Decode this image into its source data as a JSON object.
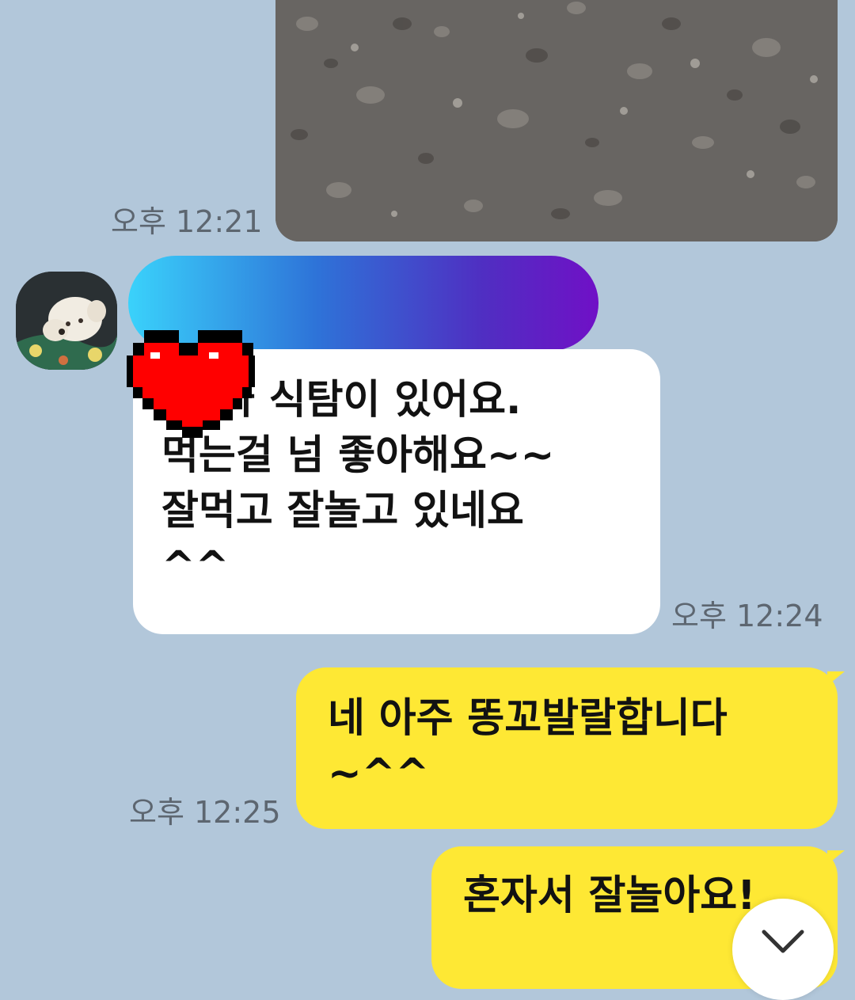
{
  "chat": {
    "messages": [
      {
        "sender": "me",
        "type": "photo",
        "time": "오후 12:21"
      },
      {
        "sender": "partner",
        "type": "text",
        "text": "    가 식탐이 있어요.\n먹는걸 넘 좋아해요~~\n잘먹고 잘놀고 있네요\n^^",
        "time": "오후 12:24"
      },
      {
        "sender": "me",
        "type": "text",
        "text": "네 아주 똥꼬발랄합니다\n~^^",
        "time": "오후 12:25"
      },
      {
        "sender": "me",
        "type": "text",
        "text": "혼자서 잘놀아요!"
      }
    ]
  },
  "icons": {
    "avatar": "dog-avatar",
    "redaction": "pixel-heart-icon",
    "scroll": "chevron-down-icon"
  },
  "colors": {
    "background": "#b2c7da",
    "incoming_bubble": "#ffffff",
    "outgoing_bubble": "#fee834",
    "heart": "#ff0000"
  }
}
